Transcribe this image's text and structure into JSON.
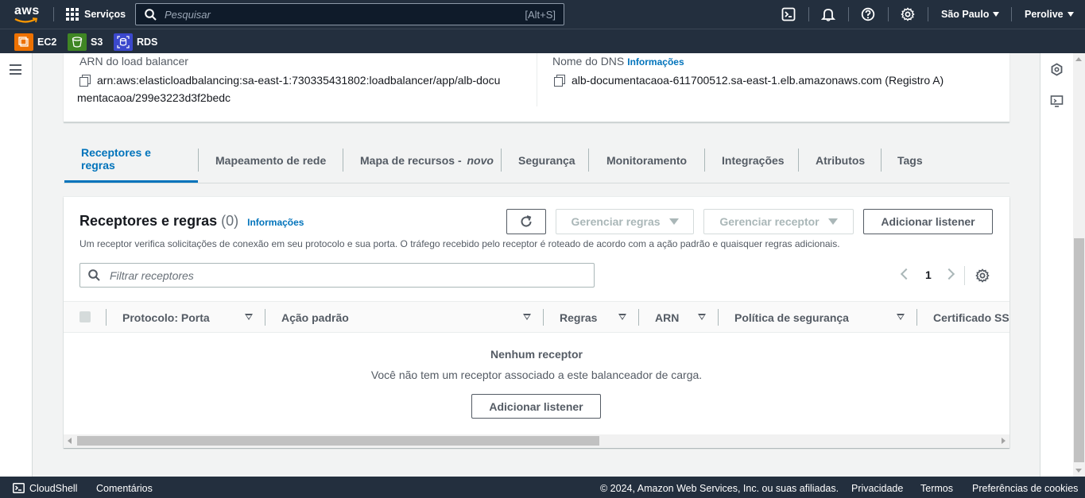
{
  "topnav": {
    "logo_text": "aws",
    "services_label": "Serviços",
    "search_placeholder": "Pesquisar",
    "search_shortcut": "[Alt+S]",
    "region": "São Paulo",
    "account": "Perolive"
  },
  "favorites": [
    {
      "label": "EC2",
      "color": "#ed7100"
    },
    {
      "label": "S3",
      "color": "#3f8624"
    },
    {
      "label": "RDS",
      "color": "#3b48cc"
    }
  ],
  "details": {
    "arn_label": "ARN do load balancer",
    "arn_value_line1": "arn:aws:elasticloadbalancing:sa-east-1:730335431802:loadbalancer/app/alb-docu",
    "arn_value_line2": "mentacaoa/299e3223d3f2bedc",
    "dns_label": "Nome do DNS",
    "dns_info": "Informações",
    "dns_value": "alb-documentacaoa-611700512.sa-east-1.elb.amazonaws.com (Registro A)"
  },
  "tabs": [
    {
      "label": "Receptores e regras"
    },
    {
      "label": "Mapeamento de rede"
    },
    {
      "label": "Mapa de recursos - ",
      "suffix": "novo"
    },
    {
      "label": "Segurança"
    },
    {
      "label": "Monitoramento"
    },
    {
      "label": "Integrações"
    },
    {
      "label": "Atributos"
    },
    {
      "label": "Tags"
    }
  ],
  "panel": {
    "title": "Receptores e regras",
    "count": "(0)",
    "info": "Informações",
    "description": "Um receptor verifica solicitações de conexão em seu protocolo e sua porta. O tráfego recebido pelo receptor é roteado de acordo com a ação padrão e quaisquer regras adicionais.",
    "manage_rules": "Gerenciar regras",
    "manage_listener": "Gerenciar receptor",
    "add_listener": "Adicionar listener",
    "filter_placeholder": "Filtrar receptores",
    "page": "1",
    "columns": [
      "Protocolo: Porta",
      "Ação padrão",
      "Regras",
      "ARN",
      "Política de segurança",
      "Certificado SSL"
    ],
    "empty_title": "Nenhum receptor",
    "empty_desc": "Você não tem um receptor associado a este balanceador de carga.",
    "empty_button": "Adicionar listener"
  },
  "footer": {
    "cloudshell": "CloudShell",
    "feedback": "Comentários",
    "copyright": "© 2024, Amazon Web Services, Inc. ou suas afiliadas.",
    "privacy": "Privacidade",
    "terms": "Termos",
    "cookies": "Preferências de cookies"
  }
}
